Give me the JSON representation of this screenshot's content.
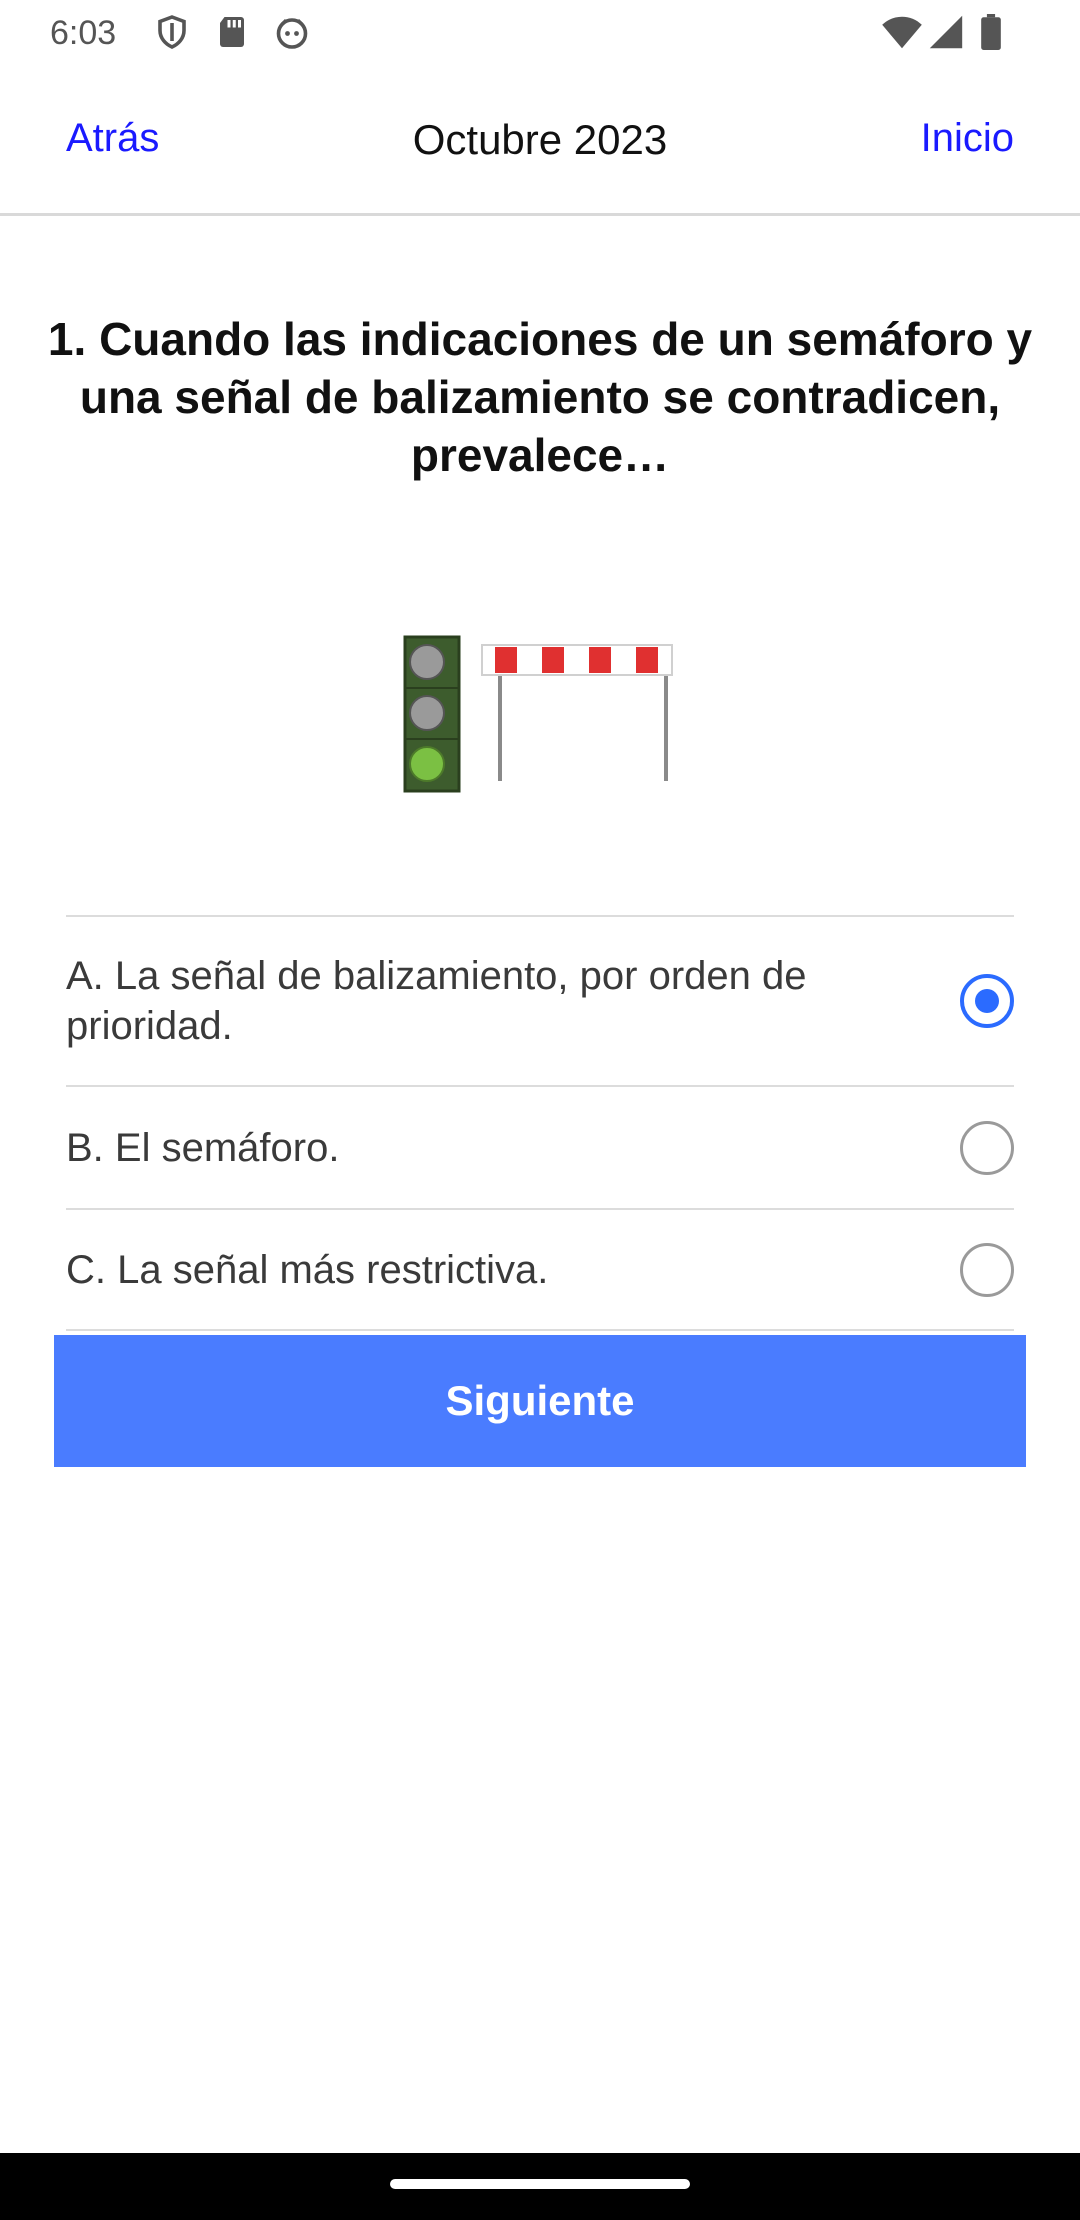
{
  "status_bar": {
    "time": "6:03",
    "left_icons": [
      "shield-icon",
      "sd-card-icon",
      "android-face-icon"
    ],
    "right_icons": [
      "wifi-icon",
      "signal-icon",
      "battery-icon"
    ]
  },
  "nav": {
    "back_label": "Atrás",
    "title": "Octubre 2023",
    "home_label": "Inicio"
  },
  "question": {
    "text": "1. Cuando las indicaciones de un semáforo y una señal de balizamiento se contradicen, prevalece…"
  },
  "options": [
    {
      "label": "A. La señal de balizamiento, por orden de prioridad.",
      "selected": true
    },
    {
      "label": "B. El semáforo.",
      "selected": false
    },
    {
      "label": "C. La señal más restrictiva.",
      "selected": false
    }
  ],
  "next_button": {
    "label": "Siguiente"
  },
  "colors": {
    "link": "#1a1aff",
    "accent": "#4a7cff",
    "radio_selected": "#2b6bff",
    "traffic_green": "#7bc043",
    "barrier_red": "#e03030"
  }
}
